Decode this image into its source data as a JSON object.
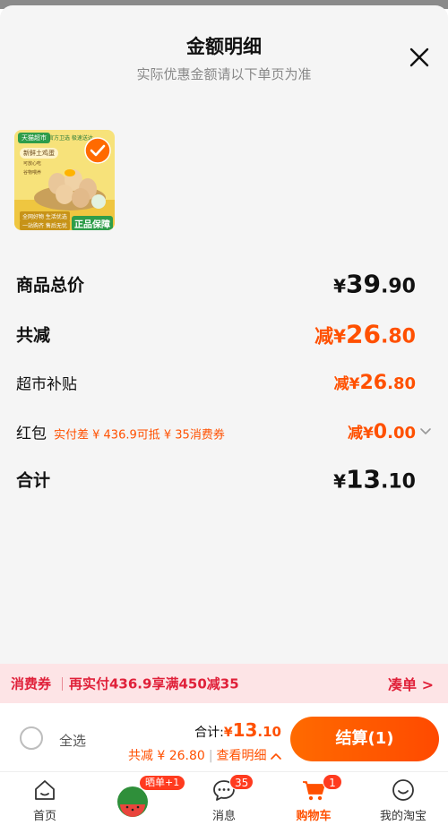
{
  "header": {
    "title": "金额明细",
    "subtitle": "实际优惠金额请以下单页为准"
  },
  "product": {
    "tag": "天猫超市",
    "sub": "官方卫选 极速送达",
    "name": "新鲜土鸡蛋",
    "bullet1": "可放心吃",
    "bullet2": "谷物喂养",
    "badge1": "全网好物 生活优选",
    "badge2": "一站购齐 售后无忧",
    "guarantee": "正品保障"
  },
  "summary": {
    "total": {
      "label": "商品总价",
      "currency": "¥",
      "int": "39",
      "dec": ".90"
    },
    "reduce": {
      "label": "共减",
      "prefix": "减",
      "currency": "¥",
      "int": "26",
      "dec": ".80"
    },
    "subsidy": {
      "label": "超市补贴",
      "prefix": "减",
      "currency": "¥",
      "int": "26",
      "dec": ".80"
    },
    "hongbao": {
      "label": "红包",
      "note": "实付差 ¥ 436.9可抵 ¥ 35消费券",
      "prefix": "减",
      "currency": "¥",
      "int": "0",
      "dec": ".00"
    },
    "sum": {
      "label": "合计",
      "currency": "¥",
      "int": "13",
      "dec": ".10"
    }
  },
  "coupon": {
    "label": "消费券",
    "text": "再实付436.9享满450减35",
    "action": "凑单 >"
  },
  "checkout": {
    "select_all": "全选",
    "total_label": "合计:",
    "total_currency": "¥",
    "total_int": "13",
    "total_dec": ".10",
    "discount": "共减 ¥ 26.80",
    "detail": "查看明细",
    "button": "结算(1)"
  },
  "tabs": [
    {
      "label": "首页",
      "icon": "home-icon"
    },
    {
      "label": "",
      "icon": "watermelon-icon",
      "pill": "晒单+1"
    },
    {
      "label": "消息",
      "icon": "message-icon",
      "badge": "35"
    },
    {
      "label": "购物车",
      "icon": "cart-icon",
      "badge": "1",
      "active": true
    },
    {
      "label": "我的淘宝",
      "icon": "profile-icon"
    }
  ],
  "colors": {
    "accent": "#ff5000",
    "coupon_bg": "#fde4e6",
    "coupon_text": "#e0213a"
  }
}
